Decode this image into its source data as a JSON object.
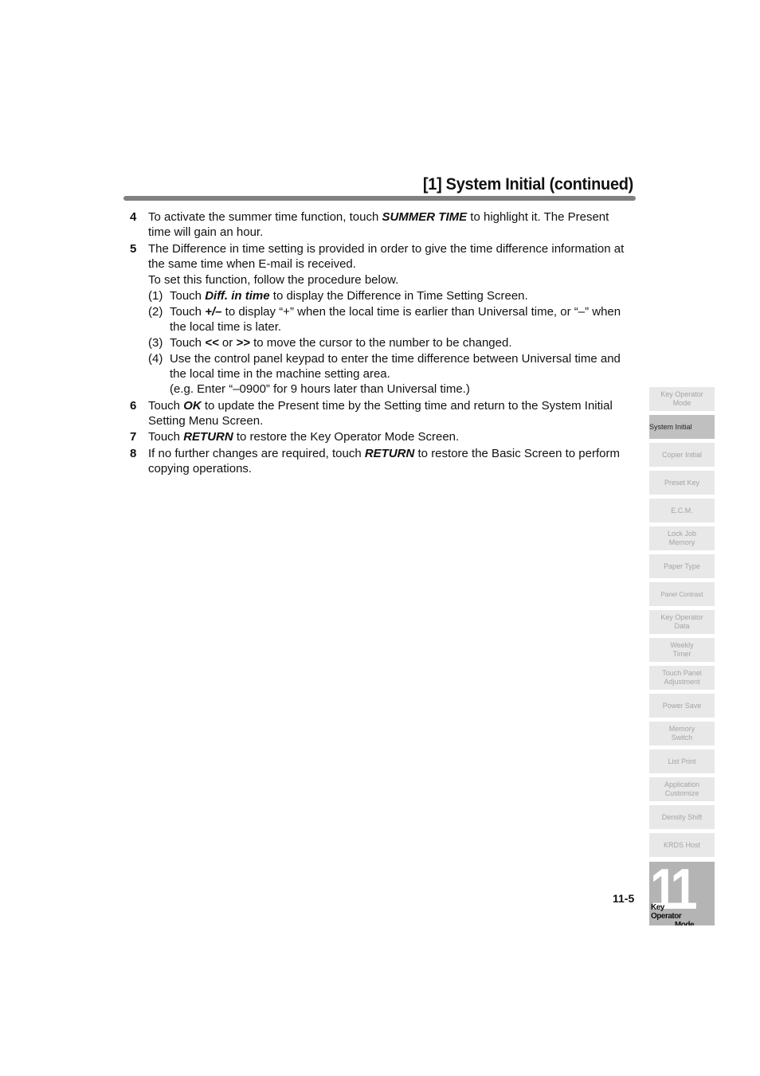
{
  "header": {
    "title": "[1] System Initial (continued)"
  },
  "steps": {
    "s4": {
      "num": "4",
      "pre": "To activate the summer time function, touch ",
      "key": "SUMMER TIME",
      "post": " to highlight it. The Present time will gain an hour."
    },
    "s5": {
      "num": "5",
      "text": "The Difference in time setting is provided in order to give the time difference information at the same time when E-mail is received.",
      "intro": "To set this function, follow the procedure below.",
      "sub1": {
        "num": "(1)",
        "pre": "Touch ",
        "key": "Diff. in time",
        "post": " to display the Difference in Time Setting Screen."
      },
      "sub2": {
        "num": "(2)",
        "pre": "Touch ",
        "key": "+/–",
        "post": " to display “+” when the local time is earlier than Universal time, or “–” when the local time is later."
      },
      "sub3": {
        "num": "(3)",
        "pre": "Touch ",
        "key1": "<<",
        "mid": " or ",
        "key2": ">>",
        "post": " to move the cursor to the number to be changed."
      },
      "sub4": {
        "num": "(4)",
        "text": "Use the control panel keypad to enter the time difference between Universal time and the local time in the machine setting area.",
        "example": "(e.g. Enter “–0900” for 9 hours later than Universal time.)"
      }
    },
    "s6": {
      "num": "6",
      "pre": "Touch ",
      "key": "OK",
      "post": " to update the Present time by the Setting time and return to the System Initial Setting Menu Screen."
    },
    "s7": {
      "num": "7",
      "pre": "Touch ",
      "key": "RETURN",
      "post": " to restore the Key Operator Mode Screen."
    },
    "s8": {
      "num": "8",
      "pre": "If no further changes are required, touch ",
      "key": "RETURN",
      "post": " to restore the Basic Screen to perform copying operations."
    }
  },
  "sidebar": {
    "tabs": [
      {
        "label": "Key Operator\nMode"
      },
      {
        "label": "System Initial"
      },
      {
        "label": "Copier Initial"
      },
      {
        "label": "Preset Key"
      },
      {
        "label": "E.C.M."
      },
      {
        "label": "Lock Job\nMemory"
      },
      {
        "label": "Paper Type"
      },
      {
        "label": "Panel Contrast"
      },
      {
        "label": "Key Operator\nData"
      },
      {
        "label": "Weekly\nTimer"
      },
      {
        "label": "Touch Panel\nAdjustment"
      },
      {
        "label": "Power Save"
      },
      {
        "label": "Memory\nSwitch"
      },
      {
        "label": "List Print"
      },
      {
        "label": "Application\nCustomize"
      },
      {
        "label": "Density Shift"
      },
      {
        "label": "KRDS Host"
      }
    ],
    "active_tab": "System Initial"
  },
  "chapter": {
    "number": "11",
    "label_line1": "Key Operator",
    "label_line2": "Mode"
  },
  "footer": {
    "page_number": "11-5"
  }
}
